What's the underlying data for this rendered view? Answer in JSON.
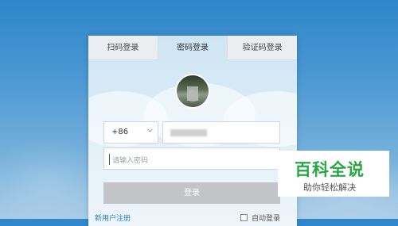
{
  "tabs": [
    {
      "label": "扫码登录",
      "active": false
    },
    {
      "label": "密码登录",
      "active": true
    },
    {
      "label": "验证码登录",
      "active": false
    }
  ],
  "country_code": {
    "value": "+86"
  },
  "password": {
    "placeholder": "请输入密码"
  },
  "login_button": {
    "label": "登录"
  },
  "register_link": {
    "label": "新用户注册"
  },
  "auto_login": {
    "label": "自动登录",
    "checked": false
  },
  "watermark": {
    "title": "百科全说",
    "subtitle": "助你轻松解决"
  },
  "colors": {
    "accent_link": "#2d7fd0",
    "watermark_green": "#27a744",
    "button_disabled": "#c2c4c7"
  }
}
